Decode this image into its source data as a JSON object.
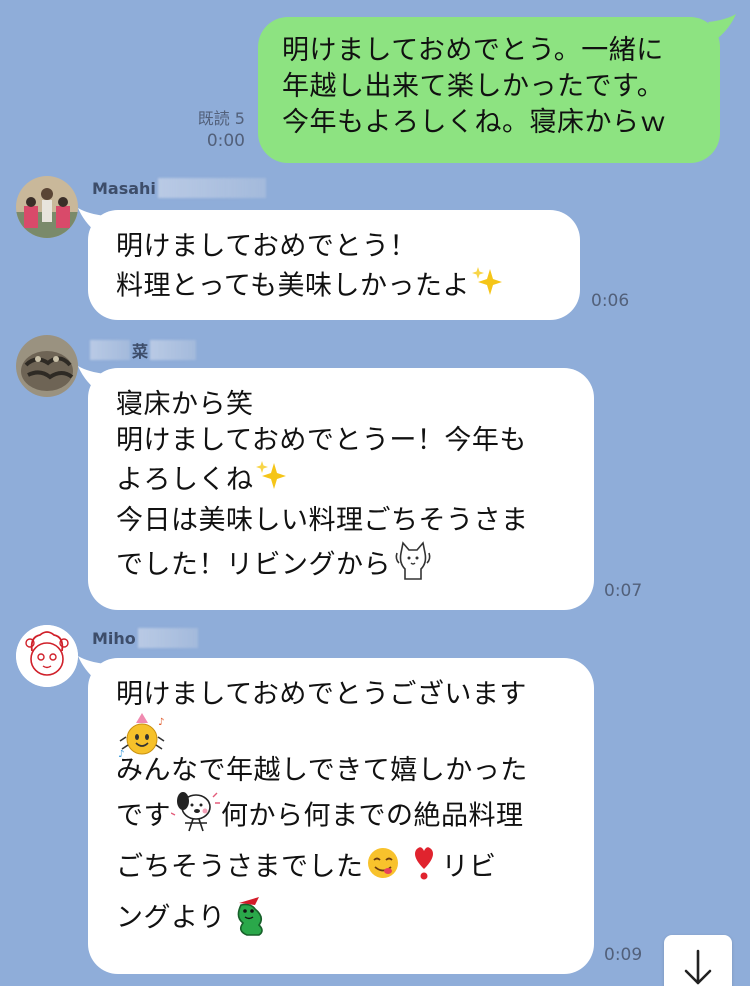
{
  "messages": [
    {
      "id": "m1",
      "side": "me",
      "lines": [
        "明けましておめでとう。一緒に",
        "年越し出来て楽しかったです。",
        "今年もよろしくね。寝床からｗ"
      ],
      "read_status": "既読 5",
      "time": "0:00"
    },
    {
      "id": "m2",
      "side": "them",
      "sender_name": "Masahi",
      "lines": [
        "明けましておめでとう！",
        "料理とっても美味しかったよ"
      ],
      "emojis": [
        "sparkles"
      ],
      "time": "0:06"
    },
    {
      "id": "m3",
      "side": "them",
      "sender_name": "菜",
      "lines": [
        "寝床から笑",
        "明けましておめでとうー！今年も",
        "よろしくね",
        "今日は美味しい料理ごちそうさま",
        "でした！リビングから"
      ],
      "emojis": [
        "sparkles",
        "cat-sticker"
      ],
      "time": "0:07"
    },
    {
      "id": "m4",
      "side": "them",
      "sender_name": "Miho",
      "lines": [
        "明けましておめでとうございます",
        "",
        "みんなで年越しできて嬉しかった",
        "です",
        "何から何までの絶品料理",
        "ごちそうさまでした",
        "リビ",
        "ングより"
      ],
      "emojis": [
        "party-face-sticker",
        "dog-sticker",
        "yum-face",
        "heart-exclamation",
        "worm-sticker"
      ],
      "time": "0:09"
    }
  ],
  "colors": {
    "background": "#8fadd9",
    "my_bubble": "#8de381",
    "their_bubble": "#ffffff",
    "meta_text": "#52607a"
  },
  "scroll_button": {
    "icon": "arrow-down-icon"
  }
}
